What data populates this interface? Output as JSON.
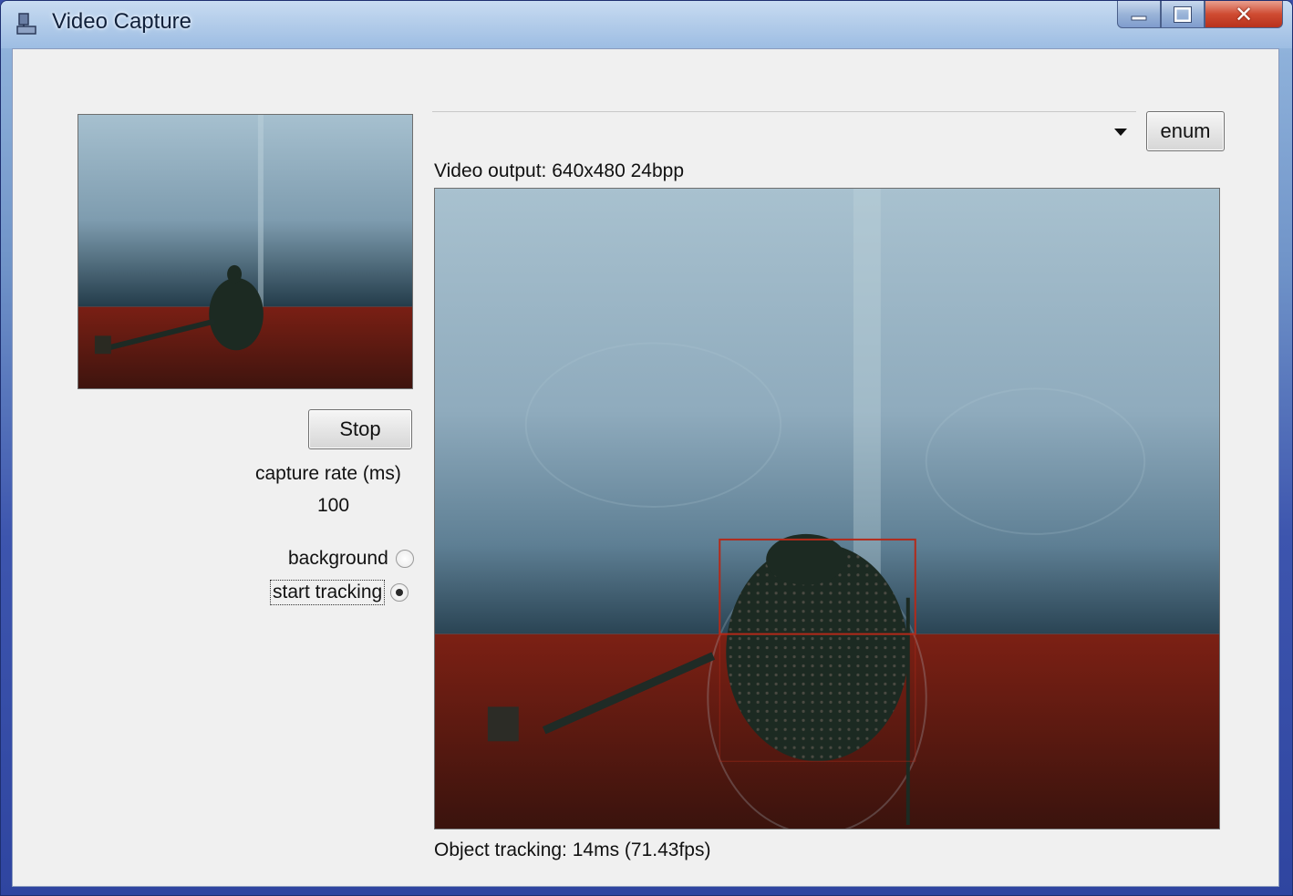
{
  "window": {
    "title": "Video Capture",
    "close_glyph": "✕"
  },
  "controls": {
    "stop_label": "Stop",
    "capture_rate_label": "capture rate (ms)",
    "capture_rate_value": "100",
    "background_label": "background",
    "background_selected": false,
    "start_tracking_label": "start tracking",
    "start_tracking_selected": true
  },
  "device": {
    "selected": "",
    "enum_label": "enum"
  },
  "output": {
    "video_label": "Video output: 640x480 24bpp",
    "tracking_label": "Object tracking: 14ms (71.43fps)"
  },
  "icons": {
    "app": "app-icon",
    "minimize": "minimize-icon",
    "maximize": "maximize-icon",
    "close": "close-icon",
    "dropdown": "chevron-down-icon"
  },
  "colors": {
    "wall": "#9fb8c6",
    "table": "#6e1c12",
    "object": "#1c2a22",
    "tracking_box": "#b32a1a"
  }
}
